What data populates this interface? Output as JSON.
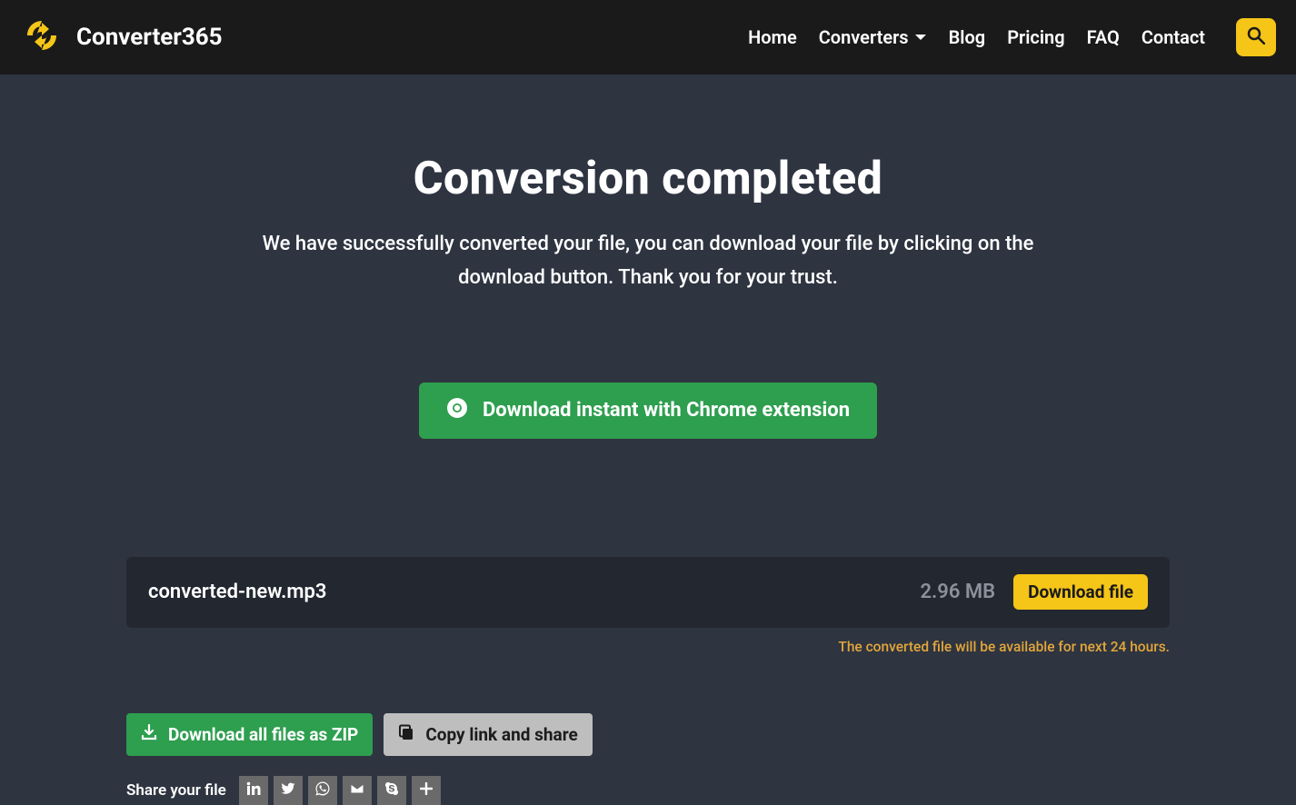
{
  "brand": "Converter365",
  "nav": {
    "home": "Home",
    "converters": "Converters",
    "blog": "Blog",
    "pricing": "Pricing",
    "faq": "FAQ",
    "contact": "Contact"
  },
  "page": {
    "title": "Conversion completed",
    "subtitle": "We have successfully converted your file, you can download your file by clicking on the download button. Thank you for your trust.",
    "chrome_button": "Download instant with Chrome extension"
  },
  "file": {
    "name": "converted-new.mp3",
    "size": "2.96 MB",
    "download_label": "Download file"
  },
  "notice": "The converted file will be available for next 24 hours.",
  "actions": {
    "zip": "Download all files as ZIP",
    "copy": "Copy link and share"
  },
  "share": {
    "label": "Share your file"
  }
}
